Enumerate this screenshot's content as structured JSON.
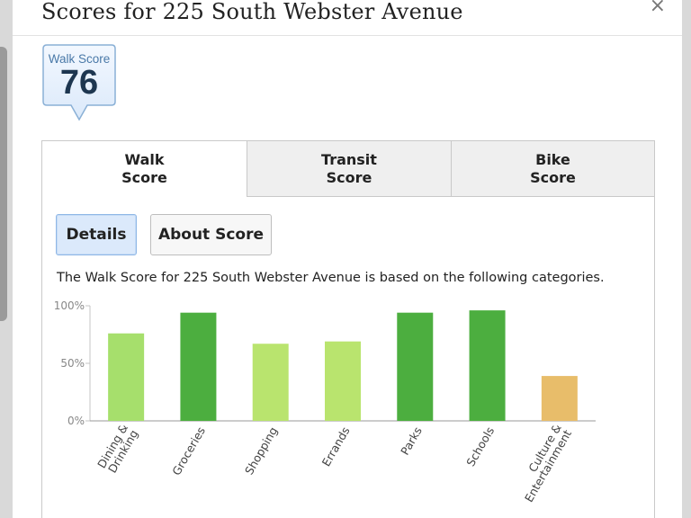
{
  "modal": {
    "title": "Scores for 225 South Webster Avenue",
    "close_symbol": "×"
  },
  "badge": {
    "label": "Walk Score",
    "value": "76"
  },
  "tabs": [
    {
      "label": "Walk\nScore",
      "active": true
    },
    {
      "label": "Transit\nScore",
      "active": false
    },
    {
      "label": "Bike\nScore",
      "active": false
    }
  ],
  "buttons": {
    "details": "Details",
    "about": "About Score"
  },
  "description": "The Walk Score for 225 South Webster Avenue is based on the following categories.",
  "colors": {
    "high": "#4cae3f",
    "medium": "#a6df6c",
    "medium_light": "#b9e46e",
    "low": "#e8bd6a"
  },
  "chart_data": {
    "type": "bar",
    "categories": [
      "Dining & Drinking",
      "Groceries",
      "Shopping",
      "Errands",
      "Parks",
      "Schools",
      "Culture & Entertainment"
    ],
    "category_lines": [
      [
        "Dining &",
        "Drinking"
      ],
      [
        "Groceries"
      ],
      [
        "Shopping"
      ],
      [
        "Errands"
      ],
      [
        "Parks"
      ],
      [
        "Schools"
      ],
      [
        "Culture &",
        "Entertainment"
      ]
    ],
    "values": [
      76,
      94,
      67,
      69,
      94,
      96,
      39
    ],
    "bar_colors": [
      "#a6df6c",
      "#4cae3f",
      "#b9e46e",
      "#b9e46e",
      "#4cae3f",
      "#4cae3f",
      "#e8bd6a"
    ],
    "yticks": [
      "0%",
      "50%",
      "100%"
    ],
    "ylim": [
      0,
      100
    ]
  }
}
